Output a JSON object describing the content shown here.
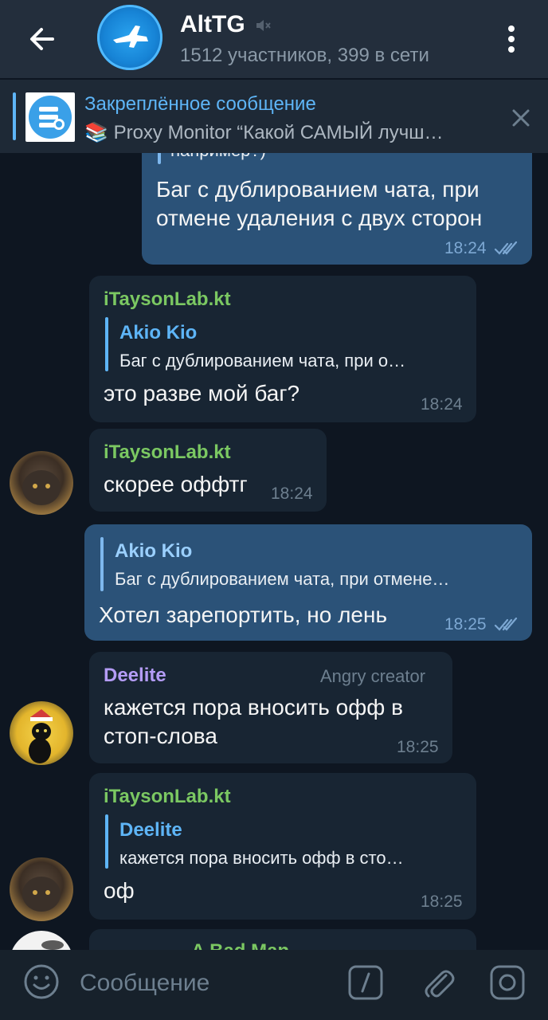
{
  "header": {
    "title": "AltTG",
    "subtitle": "1512 участников, 399 в сети"
  },
  "pinned": {
    "title": "Закреплённое сообщение",
    "preview_emoji": "📚",
    "preview": "Proxy Monitor  “Какой САМЫЙ лучш…"
  },
  "messages": [
    {
      "id": "m1",
      "direction": "out",
      "partial_top": "например?)",
      "text": "Баг с дублированием чата, при отмене удаления с двух сторон",
      "time": "18:24",
      "read": true
    },
    {
      "id": "m2",
      "direction": "in",
      "sender": "iTaysonLab.kt",
      "reply_name": "Akio Kio",
      "reply_text": "Баг с дублированием чата, при о…",
      "text": "это разве мой баг?",
      "time": "18:24"
    },
    {
      "id": "m3",
      "direction": "in",
      "sender": "iTaysonLab.kt",
      "text": "скорее оффтг",
      "time": "18:24"
    },
    {
      "id": "m4",
      "direction": "out",
      "reply_name": "Akio Kio",
      "reply_text": "Баг с дублированием чата, при отмене…",
      "text": "Хотел зарепортить, но лень",
      "time": "18:25",
      "read": true
    },
    {
      "id": "m5",
      "direction": "in",
      "sender": "Deelite",
      "sender_badge": "Angry creator",
      "text": "кажется пора вносить офф в стоп-слова",
      "time": "18:25"
    },
    {
      "id": "m6",
      "direction": "in",
      "sender": "iTaysonLab.kt",
      "reply_name": "Deelite",
      "reply_text": "кажется пора вносить офф в сто…",
      "text": "оф",
      "time": "18:25"
    },
    {
      "id": "m7",
      "direction": "in",
      "sender": "A Bad Man",
      "partial": true
    }
  ],
  "composer": {
    "placeholder": "Сообщение"
  },
  "colors": {
    "background": "#0e1621",
    "header": "#232e3c",
    "incoming": "#182533",
    "outgoing": "#2b5278",
    "accent": "#5eb5f7",
    "sender_green": "#7bc862",
    "sender_purple": "#b49cf6"
  },
  "icons": [
    "back-arrow-icon",
    "mute-icon",
    "more-vert-icon",
    "close-icon",
    "emoji-icon",
    "command-slash-icon",
    "attach-icon",
    "camera-icon",
    "double-check-icon"
  ]
}
